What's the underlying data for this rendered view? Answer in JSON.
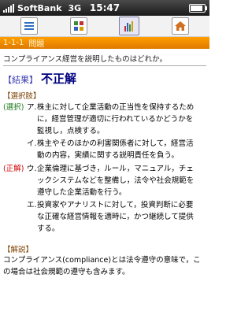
{
  "status_bar": {
    "carrier": "SoftBank",
    "network": "3G",
    "time": "15:47"
  },
  "toolbar": {
    "icons": [
      "menu-icon",
      "grid-icon",
      "chart-icon",
      "home-icon"
    ]
  },
  "question": {
    "number": "1-1-1",
    "label": "問題",
    "text": "コンプライアンス経営を説明したものはどれか。"
  },
  "result": {
    "label": "【結果】",
    "value": "不正解"
  },
  "choices": {
    "heading": "【選択肢】",
    "items": [
      {
        "tag": "(選択)",
        "mark": "ア.",
        "text": "株主に対して企業活動の正当性を保持するために，経営管理が適切に行われているかどうかを監視し，点検する。"
      },
      {
        "tag": "",
        "mark": "イ.",
        "text": "株主やそのほかの利害関係者に対して，経営活動の内容，実績に関する説明責任を負う。"
      },
      {
        "tag": "(正解)",
        "mark": "ウ.",
        "text": "企業倫理に基づき，ルール，マニュアル，チェックシステムなどを整備し，法令や社会規範を遵守した企業活動を行う。"
      },
      {
        "tag": "",
        "mark": "エ.",
        "text": "投資家やアナリストに対して，投資判断に必要な正確な経営情報を適時に，かつ継続して提供する。"
      }
    ]
  },
  "explanation": {
    "heading": "【解説】",
    "text": "コンプライアンス(compliance)とは法令遵守の意味で，この場合は社会規範の遵守も含みます。"
  },
  "colors": {
    "header_orange": "#f08800",
    "correct_red": "#d00000",
    "selected_green": "#1a7a1a",
    "result_navy": "#000080"
  }
}
